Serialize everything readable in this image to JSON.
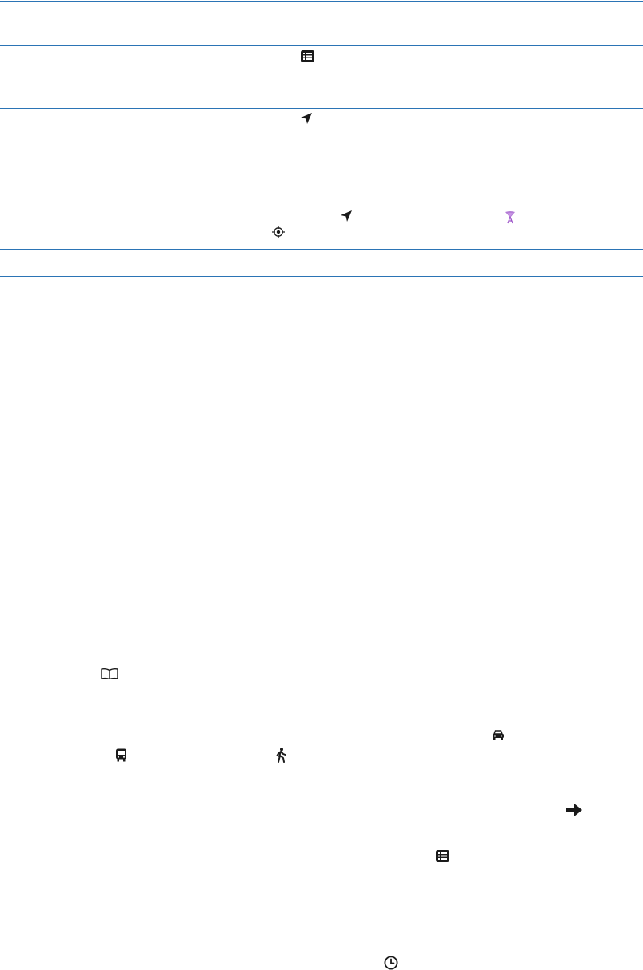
{
  "colors": {
    "rule": "#2b74b5",
    "icon": "#1a1a1a",
    "icon_wifi": "#9b51c8"
  },
  "table": {
    "rows": [
      {
        "icons": []
      },
      {
        "icons": [
          "list-icon"
        ]
      },
      {
        "icons": [
          "location-arrow-icon"
        ]
      },
      {
        "icons": [
          "location-arrow-icon",
          "wifi-location-icon",
          "gps-crosshair-icon"
        ]
      },
      {
        "icons": []
      }
    ]
  },
  "body_icons": [
    "bookmarks-icon",
    "car-icon",
    "bus-icon",
    "walking-icon",
    "arrow-right-icon",
    "list-icon",
    "clock-icon"
  ]
}
